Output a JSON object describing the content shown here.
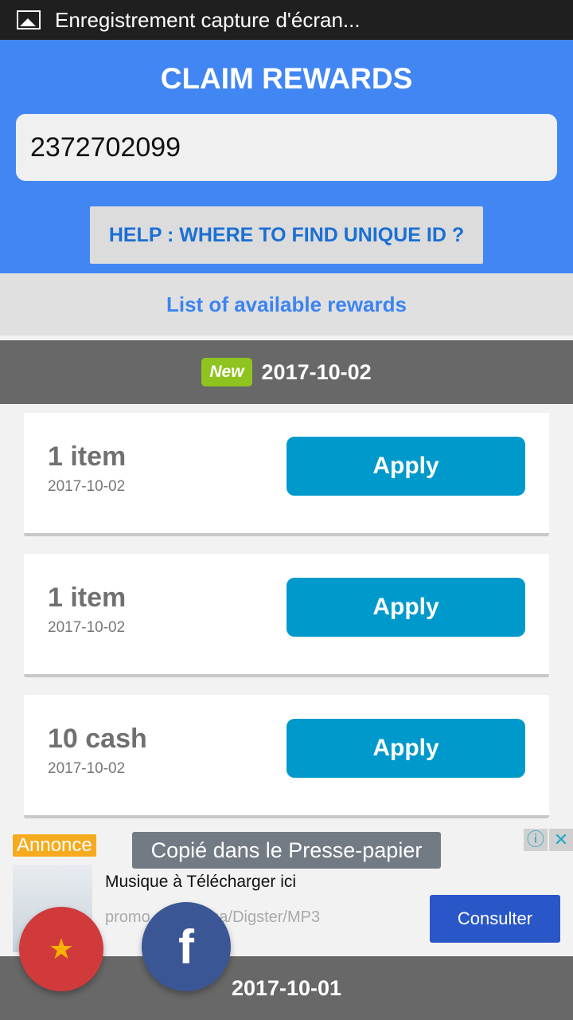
{
  "status_bar": {
    "notification": "Enregistrement capture d'écran..."
  },
  "header": {
    "title": "CLAIM REWARDS",
    "unique_id_value": "2372702099",
    "help_label": "HELP : WHERE TO FIND UNIQUE ID ?"
  },
  "list_header": "List of available rewards",
  "groups": [
    {
      "badge": "New",
      "date": "2017-10-02"
    },
    {
      "date": "2017-10-01"
    }
  ],
  "rewards": [
    {
      "amount": "1 item",
      "date": "2017-10-02",
      "button": "Apply"
    },
    {
      "amount": "1 item",
      "date": "2017-10-02",
      "button": "Apply"
    },
    {
      "amount": "10 cash",
      "date": "2017-10-02",
      "button": "Apply"
    }
  ],
  "ad": {
    "label": "Annonce",
    "title": "Musique à Télécharger ici",
    "url_start": "promo",
    "url_end": "na/Digster/MP3",
    "cta": "Consulter"
  },
  "toast": "Copié dans le Presse-papier",
  "colors": {
    "header": "#4286f4",
    "apply": "#0099cc",
    "new_badge": "#8fc31f",
    "ad_cta": "#2a57c8"
  }
}
